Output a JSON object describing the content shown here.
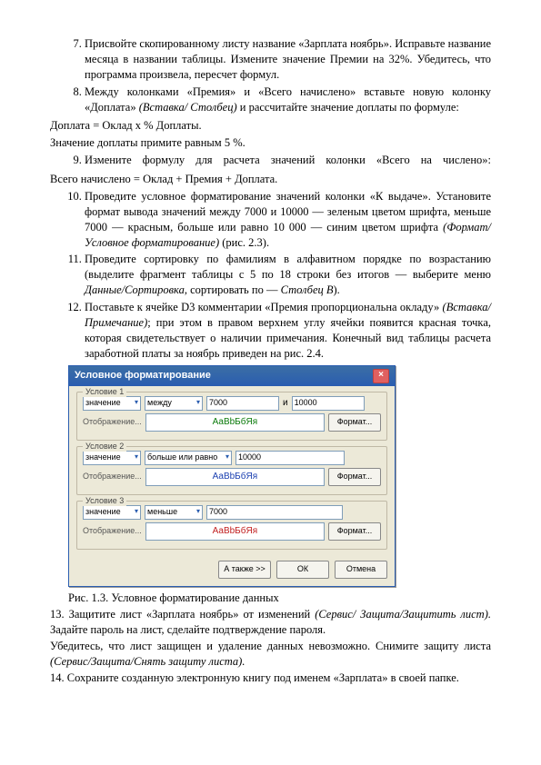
{
  "list7": "Присвойте скопированному листу название «Зарплата ноябрь». Исправьте название месяца в названии таблицы. Измените значение Премии на 32%. Убедитесь, что программа произвела, пересчет формул.",
  "list8": "Между колонками «Премия» и «Всего начислено» вставьте новую колонку «Доплата» ",
  "list8em": "(Вставка/ Столбец)",
  "list8tail": " и рассчитайте значение доплаты по формуле:",
  "doplata": "Доплата = Оклад х % Доплаты.",
  "znach": "Значение доплаты примите равным 5 %.",
  "list9": "Измените формулу для расчета значений колонки «Всего на числено»:",
  "vsego": "Всего начислено = Оклад + Премия + Доплата.",
  "list10a": "Проведите условное форматирование значений колонки «К выдаче». Установите формат вывода значений между 7000 и 10000 — зеленым цветом шрифта, меньше 7000 — красным, больше или равно 10 000 — синим цветом шрифта ",
  "list10em": "(Формат/Условное форматирование)",
  "list10tail": " (рис. 2.3).",
  "list11": "Проведите сортировку по фамилиям в алфавитном порядке по возрастанию (выделите фрагмент таблицы с 5 по 18 строки без итогов — выберите меню ",
  "list11em": "Данные/Сортировка",
  "list11mid": ", сортировать по — ",
  "list11em2": "Столбец В",
  "list11tail": ").",
  "list12a": "Поставьте к ячейке D3 комментарии «Премия пропорциональна окладу» ",
  "list12em": "(Вставка/Примечание)",
  "list12b": "; при этом в правом верхнем углу ячейки появится красная точка, которая свидетельствует о наличии примечания. Конечный вид таблицы расчета заработной платы за ноябрь приведен на рис. 2.4.",
  "dlg": {
    "title": "Условное форматирование",
    "cond1": {
      "legend": "Условие 1",
      "sel1": "значение",
      "sel2": "между",
      "v1": "7000",
      "v2": "10000",
      "fmtlabel": "Отображение...",
      "preview": "АаВbБбЯя",
      "btn": "Формат..."
    },
    "cond2": {
      "legend": "Условие 2",
      "sel1": "значение",
      "sel2": "больше или равно",
      "v1": "10000",
      "fmtlabel": "Отображение...",
      "preview": "АаВbБбЯя",
      "btn": "Формат..."
    },
    "cond3": {
      "legend": "Условие 3",
      "sel1": "значение",
      "sel2": "меньше",
      "v1": "7000",
      "fmtlabel": "Отображение...",
      "preview": "АаВbБбЯя",
      "btn": "Формат..."
    },
    "btns": {
      "addremove": "А также >>",
      "ok": "ОК",
      "cancel": "Отмена"
    }
  },
  "caption": "Рис. 1.3. Условное форматирование данных",
  "p13a": "13.      Защитите      лист      «Зарплата      ноябрь»      от      изменений      ",
  "p13em": "(Сервис/ Защита/Защитить лист).",
  "p13b": " Задайте пароль на лист, сделайте подтверждение пароля.",
  "p13c": "Убедитесь, что лист защищен и удаление данных невозможно. Снимите защиту листа ",
  "p13em2": "(Сервис/Защита/Снять защиту листа).",
  "p14": "14.     Сохраните созданную электронную книгу под именем «Зарплата» в своей папке."
}
